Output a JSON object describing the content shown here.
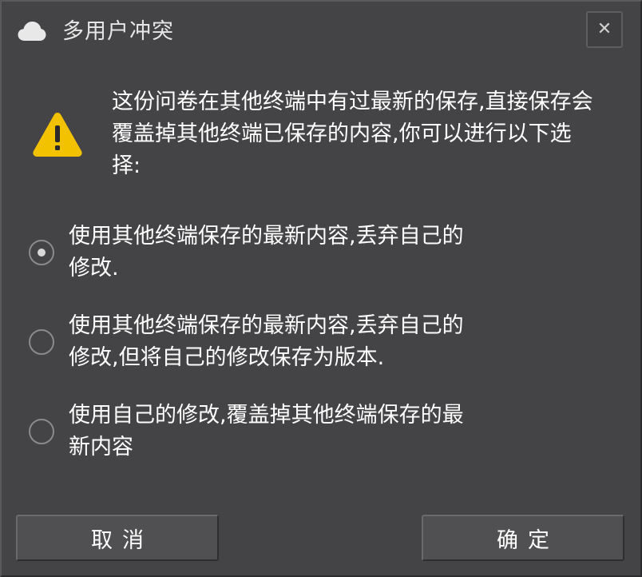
{
  "dialog": {
    "title": "多用户冲突",
    "title_icon": "cloud-icon",
    "close_icon": "close-icon",
    "close_glyph": "✕",
    "warning_icon": "warning-icon",
    "message_lines": [
      "这份问卷在其他终端中有过最新的保存,直接保存会",
      "覆盖掉其他终端已保存的内容,你可以进行以下选",
      "择:"
    ]
  },
  "options": [
    {
      "lines": [
        "使用其他终端保存的最新内容,丢弃自己的",
        "修改."
      ],
      "selected": true
    },
    {
      "lines": [
        "使用其他终端保存的最新内容,丢弃自己的",
        "修改,但将自己的修改保存为版本."
      ],
      "selected": false
    },
    {
      "lines": [
        "使用自己的修改,覆盖掉其他终端保存的最",
        "新内容"
      ],
      "selected": false
    }
  ],
  "buttons": {
    "cancel_label": "取消",
    "confirm_label": "确定"
  },
  "colors": {
    "dialog_background": "#444446",
    "warning_yellow": "#f2c200",
    "text": "#ffffff"
  }
}
